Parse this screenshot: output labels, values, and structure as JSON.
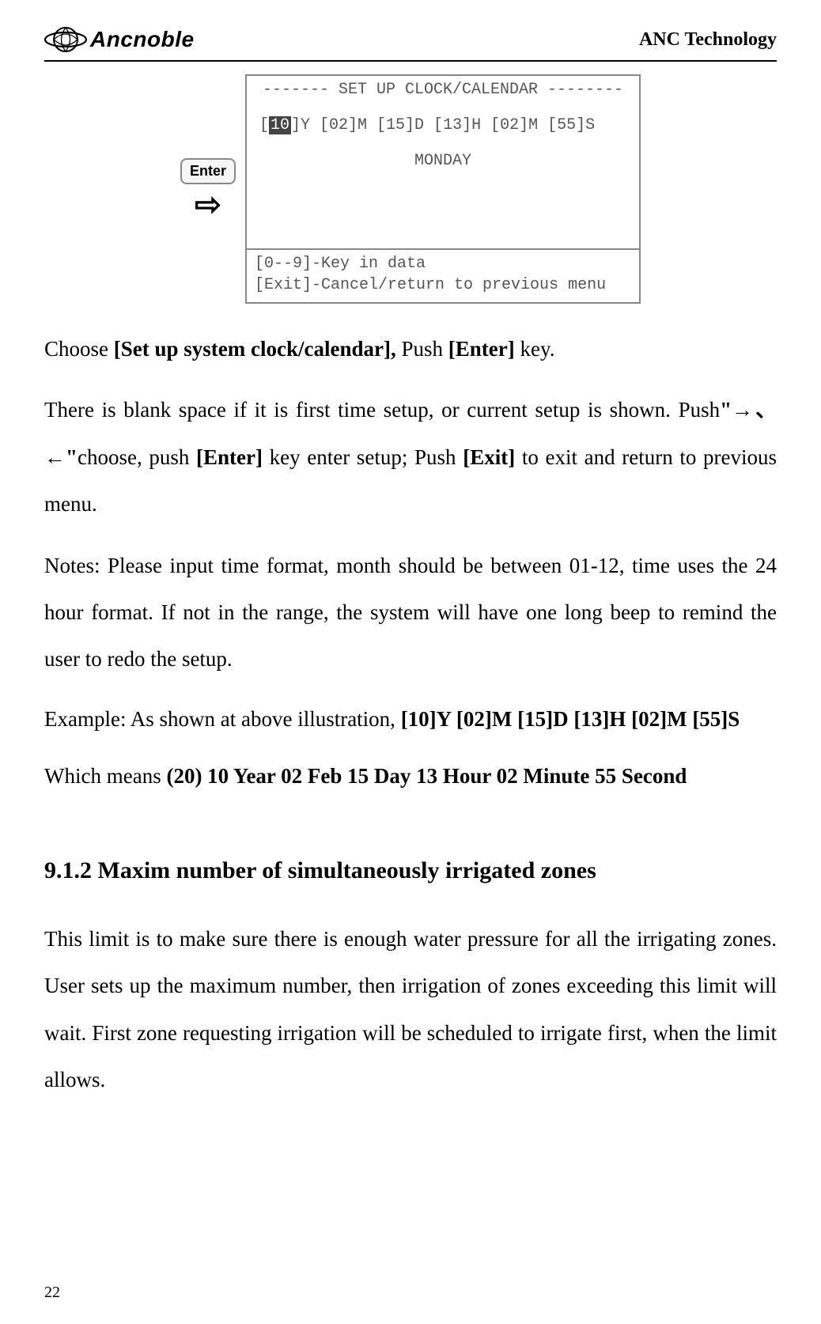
{
  "header": {
    "brand": "Ancnoble",
    "right": "ANC Technology"
  },
  "enterKey": "Enter",
  "lcd": {
    "title": "------- SET UP CLOCK/CALENDAR --------",
    "data_hl": "10",
    "data_rest": "]Y [02]M [15]D   [13]H [02]M [55]S",
    "day": "MONDAY",
    "foot1": "[0--9]-Key in data",
    "foot2": "[Exit]-Cancel/return to previous menu"
  },
  "p1": {
    "t1": "Choose ",
    "b1": "[Set up system clock/calendar],",
    "t2": " Push ",
    "b2": "[Enter]",
    "t3": " key."
  },
  "p2": {
    "t1": "There is blank space if it is first time setup, or current setup is shown. Push",
    "b1": "\"→、←\"",
    "t2": "choose, push ",
    "b2": "[Enter]",
    "t3": " key enter setup; Push ",
    "b3": "[Exit]",
    "t4": " to exit and return to previous menu."
  },
  "p3": "Notes: Please input time format, month should be between 01-12, time uses the 24 hour format. If not in the range, the system will have one long beep to remind the user to redo the setup.",
  "p4": {
    "t1": "Example: As shown at above illustration, ",
    "b1": "[10]Y [02]M [15]D     [13]H [02]M [55]S"
  },
  "p5": {
    "t1": "Which means ",
    "b1": "(20) 10 Year 02 Feb    15 Day    13 Hour    02    Minute    55 Second"
  },
  "section": "9.1.2 Maxim number of simultaneously irrigated zones",
  "p6": "This limit is to make sure there is enough water pressure for all the irrigating zones. User sets up the maximum number, then irrigation of zones exceeding this limit will wait. First zone requesting irrigation will be scheduled to irrigate first, when the limit allows.",
  "pageNumber": "22"
}
